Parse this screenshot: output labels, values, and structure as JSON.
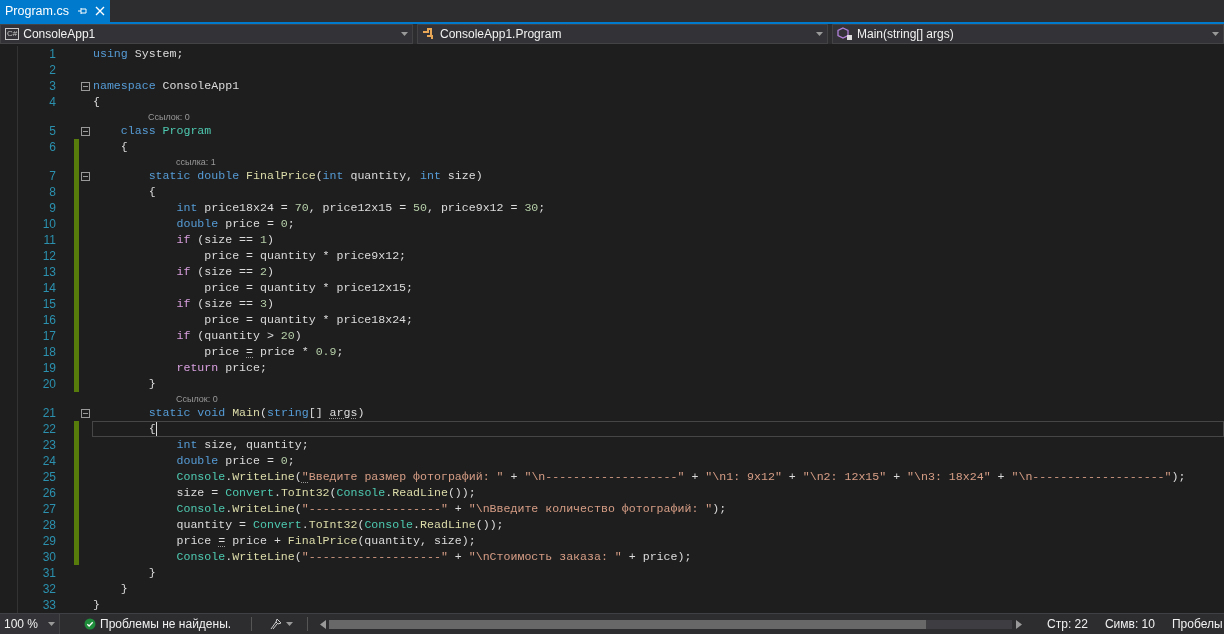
{
  "tabs": [
    {
      "label": "Program.cs",
      "selected": true
    }
  ],
  "navigation": [
    {
      "kind": "project",
      "badge": "C#",
      "label": "ConsoleApp1"
    },
    {
      "kind": "class",
      "label": "ConsoleApp1.Program"
    },
    {
      "kind": "member",
      "label": "Main(string[] args)"
    }
  ],
  "editor": {
    "lines": [
      {
        "number": "1",
        "tokens": [
          {
            "kind": "keyword",
            "text": "using"
          },
          {
            "kind": "plain",
            "text": " System;"
          }
        ]
      },
      {
        "number": "2"
      },
      {
        "number": "3",
        "fold": true,
        "tokens": [
          {
            "kind": "keyword",
            "text": "namespace"
          },
          {
            "kind": "plain",
            "text": " ConsoleApp1"
          }
        ]
      },
      {
        "number": "4",
        "tokens": [
          {
            "kind": "plain",
            "text": "{"
          }
        ]
      },
      {
        "kind": "codelens",
        "text": "Ссылок: 0"
      },
      {
        "number": "5",
        "fold": true,
        "tokens": [
          {
            "kind": "keyword",
            "text": "    class "
          },
          {
            "kind": "type",
            "text": "Program"
          }
        ]
      },
      {
        "number": "6",
        "changed": true,
        "tokens": [
          {
            "kind": "plain",
            "text": "    {"
          }
        ]
      },
      {
        "kind": "codelens",
        "text": "ссылка: 1",
        "changed": true
      },
      {
        "number": "7",
        "fold": true,
        "changed": true,
        "tokens": [
          {
            "kind": "keyword",
            "text": "        static double "
          },
          {
            "kind": "method",
            "text": "FinalPrice"
          },
          {
            "kind": "plain",
            "text": "("
          },
          {
            "kind": "keyword",
            "text": "int"
          },
          {
            "kind": "plain",
            "text": " quantity, "
          },
          {
            "kind": "keyword",
            "text": "int"
          },
          {
            "kind": "plain",
            "text": " size)"
          }
        ]
      },
      {
        "number": "8",
        "changed": true,
        "tokens": [
          {
            "kind": "plain",
            "text": "        {"
          }
        ]
      },
      {
        "number": "9",
        "changed": true,
        "tokens": [
          {
            "kind": "keyword",
            "text": "            int"
          },
          {
            "kind": "plain",
            "text": " price18x24 = "
          },
          {
            "kind": "number",
            "text": "70"
          },
          {
            "kind": "plain",
            "text": ", price12x15 = "
          },
          {
            "kind": "number",
            "text": "50"
          },
          {
            "kind": "plain",
            "text": ", price9x12 = "
          },
          {
            "kind": "number",
            "text": "30"
          },
          {
            "kind": "plain",
            "text": ";"
          }
        ]
      },
      {
        "number": "10",
        "changed": true,
        "tokens": [
          {
            "kind": "keyword",
            "text": "            double"
          },
          {
            "kind": "plain",
            "text": " price = "
          },
          {
            "kind": "number",
            "text": "0"
          },
          {
            "kind": "plain",
            "text": ";"
          }
        ]
      },
      {
        "number": "11",
        "changed": true,
        "tokens": [
          {
            "kind": "control",
            "text": "            if"
          },
          {
            "kind": "plain",
            "text": " (size == "
          },
          {
            "kind": "number",
            "text": "1"
          },
          {
            "kind": "plain",
            "text": ")"
          }
        ]
      },
      {
        "number": "12",
        "changed": true,
        "tokens": [
          {
            "kind": "plain",
            "text": "                price = quantity * price9x12;"
          }
        ]
      },
      {
        "number": "13",
        "changed": true,
        "tokens": [
          {
            "kind": "control",
            "text": "            if"
          },
          {
            "kind": "plain",
            "text": " (size == "
          },
          {
            "kind": "number",
            "text": "2"
          },
          {
            "kind": "plain",
            "text": ")"
          }
        ]
      },
      {
        "number": "14",
        "changed": true,
        "tokens": [
          {
            "kind": "plain",
            "text": "                price = quantity * price12x15;"
          }
        ]
      },
      {
        "number": "15",
        "changed": true,
        "tokens": [
          {
            "kind": "control",
            "text": "            if"
          },
          {
            "kind": "plain",
            "text": " (size == "
          },
          {
            "kind": "number",
            "text": "3"
          },
          {
            "kind": "plain",
            "text": ")"
          }
        ]
      },
      {
        "number": "16",
        "changed": true,
        "tokens": [
          {
            "kind": "plain",
            "text": "                price = quantity * price18x24;"
          }
        ]
      },
      {
        "number": "17",
        "changed": true,
        "tokens": [
          {
            "kind": "control",
            "text": "            if"
          },
          {
            "kind": "plain",
            "text": " (quantity > "
          },
          {
            "kind": "number",
            "text": "20"
          },
          {
            "kind": "plain",
            "text": ")"
          }
        ]
      },
      {
        "number": "18",
        "changed": true,
        "tokens": [
          {
            "kind": "plain",
            "text": "                price "
          },
          {
            "kind": "plain",
            "text": "=",
            "hint": true
          },
          {
            "kind": "plain",
            "text": " price * "
          },
          {
            "kind": "number",
            "text": "0.9"
          },
          {
            "kind": "plain",
            "text": ";"
          }
        ]
      },
      {
        "number": "19",
        "changed": true,
        "tokens": [
          {
            "kind": "control",
            "text": "            return"
          },
          {
            "kind": "plain",
            "text": " price;"
          }
        ]
      },
      {
        "number": "20",
        "changed": true,
        "tokens": [
          {
            "kind": "plain",
            "text": "        }"
          }
        ]
      },
      {
        "kind": "codelens",
        "text": "Ссылок: 0"
      },
      {
        "number": "21",
        "fold": true,
        "tokens": [
          {
            "kind": "keyword",
            "text": "        static void "
          },
          {
            "kind": "method",
            "text": "Main"
          },
          {
            "kind": "plain",
            "text": "("
          },
          {
            "kind": "keyword",
            "text": "string"
          },
          {
            "kind": "plain",
            "text": "[] "
          },
          {
            "kind": "plain",
            "text": "args",
            "hint": true
          },
          {
            "kind": "plain",
            "text": ")"
          }
        ]
      },
      {
        "number": "22",
        "changed": true,
        "current": true,
        "tokens": [
          {
            "kind": "plain",
            "text": "        {"
          }
        ]
      },
      {
        "number": "23",
        "changed": true,
        "tokens": [
          {
            "kind": "keyword",
            "text": "            int"
          },
          {
            "kind": "plain",
            "text": " size, quantity;"
          }
        ]
      },
      {
        "number": "24",
        "changed": true,
        "tokens": [
          {
            "kind": "keyword",
            "text": "            double"
          },
          {
            "kind": "plain",
            "text": " price = "
          },
          {
            "kind": "number",
            "text": "0"
          },
          {
            "kind": "plain",
            "text": ";"
          }
        ]
      },
      {
        "number": "25",
        "changed": true,
        "tokens": [
          {
            "kind": "type",
            "text": "            Console"
          },
          {
            "kind": "plain",
            "text": "."
          },
          {
            "kind": "method",
            "text": "WriteLine"
          },
          {
            "kind": "plain",
            "text": "("
          },
          {
            "kind": "string",
            "text": "\"",
            "hint": true
          },
          {
            "kind": "string",
            "text": "Введите размер фотографий: \""
          },
          {
            "kind": "plain",
            "text": " + "
          },
          {
            "kind": "string",
            "text": "\"\\n-------------------\""
          },
          {
            "kind": "plain",
            "text": " + "
          },
          {
            "kind": "string",
            "text": "\"\\n1: 9x12\""
          },
          {
            "kind": "plain",
            "text": " + "
          },
          {
            "kind": "string",
            "text": "\"\\n2: 12x15\""
          },
          {
            "kind": "plain",
            "text": " + "
          },
          {
            "kind": "string",
            "text": "\"\\n3: 18x24\""
          },
          {
            "kind": "plain",
            "text": " + "
          },
          {
            "kind": "string",
            "text": "\"\\n-------------------\""
          },
          {
            "kind": "plain",
            "text": ");"
          }
        ]
      },
      {
        "number": "26",
        "changed": true,
        "tokens": [
          {
            "kind": "plain",
            "text": "            size = "
          },
          {
            "kind": "type",
            "text": "Convert"
          },
          {
            "kind": "plain",
            "text": "."
          },
          {
            "kind": "method",
            "text": "ToInt32"
          },
          {
            "kind": "plain",
            "text": "("
          },
          {
            "kind": "type",
            "text": "Console"
          },
          {
            "kind": "plain",
            "text": "."
          },
          {
            "kind": "method",
            "text": "ReadLine"
          },
          {
            "kind": "plain",
            "text": "());"
          }
        ]
      },
      {
        "number": "27",
        "changed": true,
        "tokens": [
          {
            "kind": "type",
            "text": "            Console"
          },
          {
            "kind": "plain",
            "text": "."
          },
          {
            "kind": "method",
            "text": "WriteLine"
          },
          {
            "kind": "plain",
            "text": "("
          },
          {
            "kind": "string",
            "text": "\"-------------------\""
          },
          {
            "kind": "plain",
            "text": " + "
          },
          {
            "kind": "string",
            "text": "\"\\nВведите количество фотографий: \""
          },
          {
            "kind": "plain",
            "text": ");"
          }
        ]
      },
      {
        "number": "28",
        "changed": true,
        "tokens": [
          {
            "kind": "plain",
            "text": "            quantity = "
          },
          {
            "kind": "type",
            "text": "Convert"
          },
          {
            "kind": "plain",
            "text": "."
          },
          {
            "kind": "method",
            "text": "ToInt32"
          },
          {
            "kind": "plain",
            "text": "("
          },
          {
            "kind": "type",
            "text": "Console"
          },
          {
            "kind": "plain",
            "text": "."
          },
          {
            "kind": "method",
            "text": "ReadLine"
          },
          {
            "kind": "plain",
            "text": "());"
          }
        ]
      },
      {
        "number": "29",
        "changed": true,
        "tokens": [
          {
            "kind": "plain",
            "text": "            price "
          },
          {
            "kind": "plain",
            "text": "=",
            "hint": true
          },
          {
            "kind": "plain",
            "text": " price + "
          },
          {
            "kind": "method",
            "text": "FinalPrice"
          },
          {
            "kind": "plain",
            "text": "(quantity, size);"
          }
        ]
      },
      {
        "number": "30",
        "changed": true,
        "tokens": [
          {
            "kind": "type",
            "text": "            Console"
          },
          {
            "kind": "plain",
            "text": "."
          },
          {
            "kind": "method",
            "text": "WriteLine"
          },
          {
            "kind": "plain",
            "text": "("
          },
          {
            "kind": "string",
            "text": "\"-------------------\""
          },
          {
            "kind": "plain",
            "text": " + "
          },
          {
            "kind": "string",
            "text": "\"\\nСтоимость заказа: \""
          },
          {
            "kind": "plain",
            "text": " + price);"
          }
        ]
      },
      {
        "number": "31",
        "tokens": [
          {
            "kind": "plain",
            "text": "        }"
          }
        ]
      },
      {
        "number": "32",
        "tokens": [
          {
            "kind": "plain",
            "text": "    }"
          }
        ]
      },
      {
        "number": "33",
        "tokens": [
          {
            "kind": "plain",
            "text": "}"
          }
        ]
      }
    ]
  },
  "status_bar": {
    "zoom": "100 %",
    "problems": "Проблемы не найдены.",
    "line": "Стр: 22",
    "column": "Симв: 10",
    "indent": "Пробелы"
  }
}
